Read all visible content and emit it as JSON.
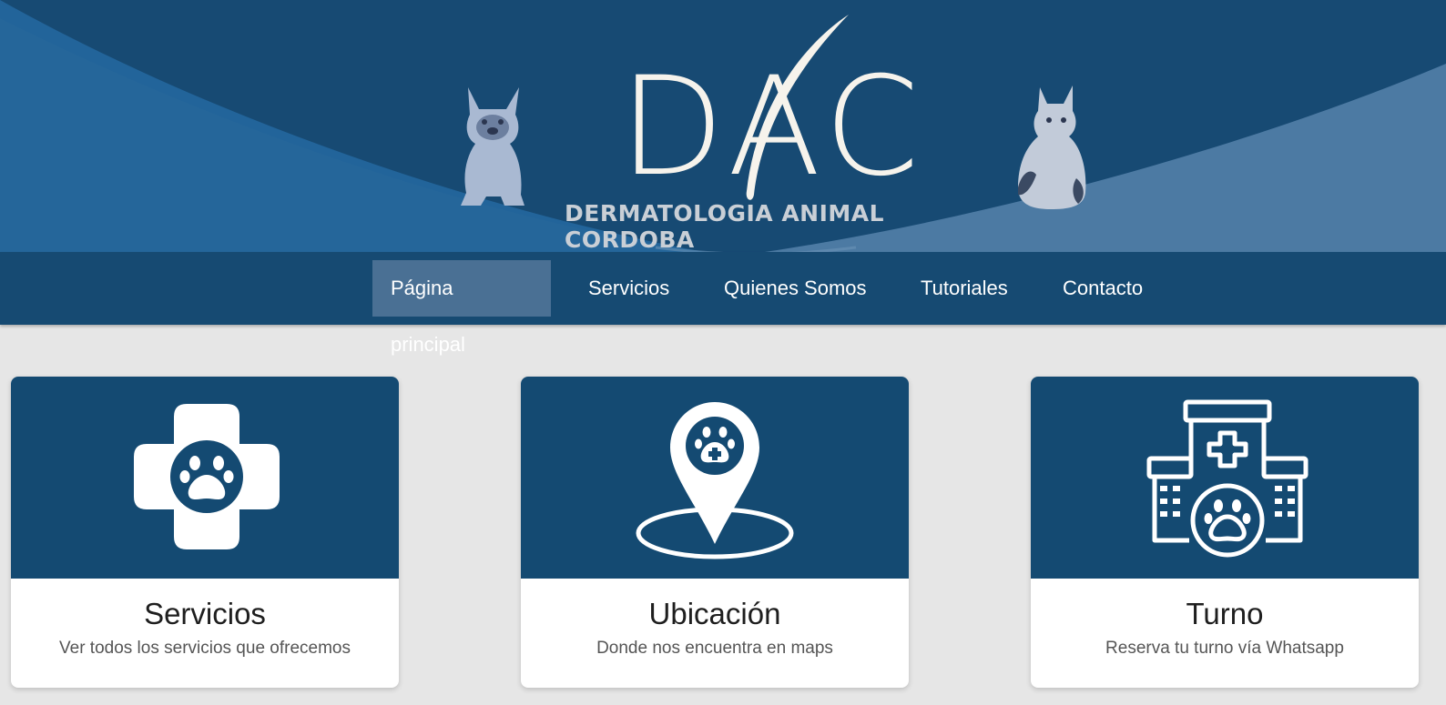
{
  "header": {
    "logo_text": "DAC",
    "logo_subtitle": "DERMATOLOGIA ANIMAL CORDOBA",
    "colors": {
      "background": "#174a73",
      "band": "#2a6a9c",
      "logo": "#f6f3ec"
    }
  },
  "nav": {
    "items": [
      {
        "label": "Página principal",
        "active": true
      },
      {
        "label": "Servicios"
      },
      {
        "label": "Quienes Somos"
      },
      {
        "label": "Tutoriales"
      },
      {
        "label": "Contacto"
      }
    ]
  },
  "cards": [
    {
      "icon": "medical-cross-paw-icon",
      "title": "Servicios",
      "description": "Ver todos los servicios que ofrecemos"
    },
    {
      "icon": "location-pin-paw-icon",
      "title": "Ubicación",
      "description": "Donde nos encuentra en maps"
    },
    {
      "icon": "veterinary-clinic-icon",
      "title": "Turno",
      "description": "Reserva tu turno vía Whatsapp"
    }
  ]
}
